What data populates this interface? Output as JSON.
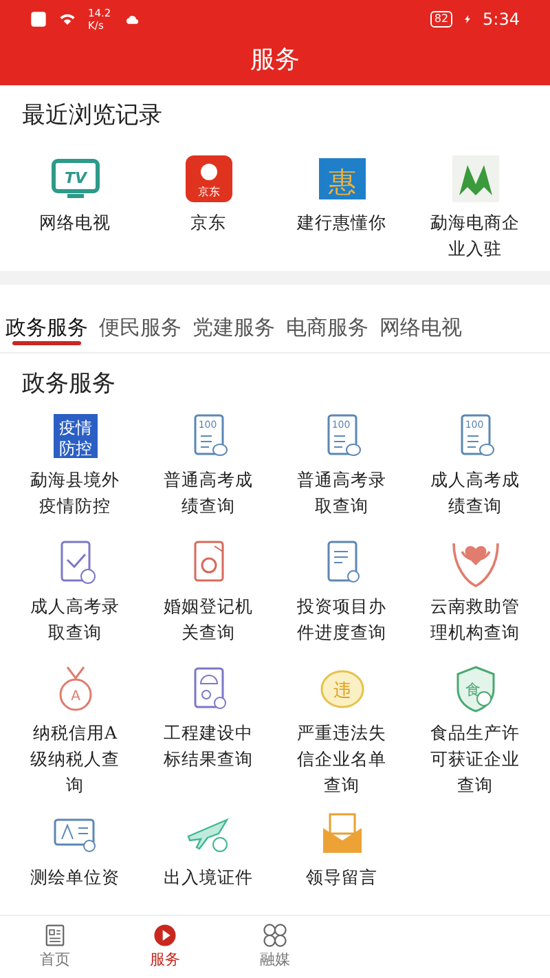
{
  "status_bar": {
    "speed_value": "14.2",
    "speed_unit": "K/s",
    "battery": "82",
    "time": "5:34"
  },
  "header": {
    "title": "服务"
  },
  "recent": {
    "title": "最近浏览记录",
    "items": [
      {
        "label": "网络电视",
        "logo_text": "TV"
      },
      {
        "label": "京东",
        "logo_text": "京东"
      },
      {
        "label": "建行惠懂你",
        "logo_text": "惠"
      },
      {
        "label": "勐海电商企业入驻"
      }
    ]
  },
  "tabs": [
    {
      "label": "政务服务",
      "selected": true
    },
    {
      "label": "便民服务",
      "selected": false
    },
    {
      "label": "党建服务",
      "selected": false
    },
    {
      "label": "电商服务",
      "selected": false
    },
    {
      "label": "网络电视",
      "selected": false
    }
  ],
  "section": {
    "title": "政务服务",
    "items": [
      {
        "label": "勐海县境外疫情防控",
        "logo_text": [
          "疫情",
          "防控"
        ]
      },
      {
        "label": "普通高考成绩查询",
        "logo_text": "100"
      },
      {
        "label": "普通高考录取查询",
        "logo_text": "100"
      },
      {
        "label": "成人高考成绩查询",
        "logo_text": "100"
      },
      {
        "label": "成人高考录取查询"
      },
      {
        "label": "婚姻登记机关查询"
      },
      {
        "label": "投资项目办件进度查询"
      },
      {
        "label": "云南救助管理机构查询"
      },
      {
        "label": "纳税信用A级纳税人查询",
        "logo_text": "A"
      },
      {
        "label": "工程建设中标结果查询"
      },
      {
        "label": "严重违法失信企业名单查询",
        "logo_text": "违"
      },
      {
        "label": "食品生产许可获证企业查询",
        "logo_text": "食"
      },
      {
        "label": "测绘单位资"
      },
      {
        "label": "出入境证件"
      },
      {
        "label": "领导留言"
      }
    ]
  },
  "bottom_nav": [
    {
      "label": "首页",
      "selected": false
    },
    {
      "label": "服务",
      "selected": true
    },
    {
      "label": "融媒",
      "selected": false
    }
  ]
}
